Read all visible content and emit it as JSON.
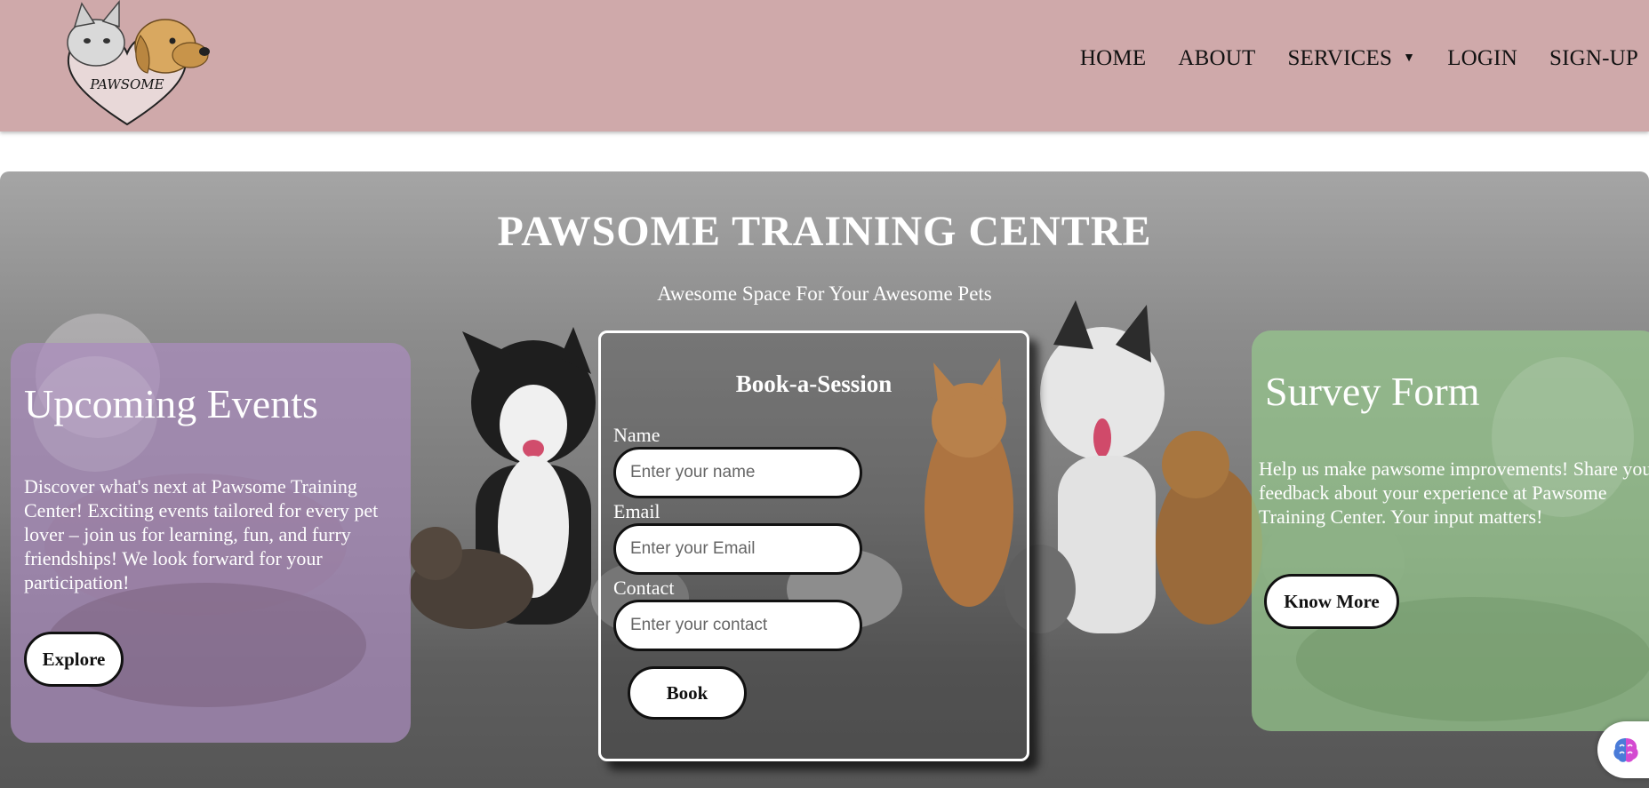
{
  "brand": {
    "logo_text": "PAWSOME"
  },
  "nav": {
    "items": [
      {
        "label": "HOME"
      },
      {
        "label": "ABOUT"
      },
      {
        "label": "SERVICES"
      },
      {
        "label": "LOGIN"
      },
      {
        "label": "SIGN-UP"
      }
    ]
  },
  "hero": {
    "title": "PAWSOME TRAINING CENTRE",
    "subtitle": "Awesome Space For Your Awesome Pets"
  },
  "events": {
    "title": "Upcoming Events",
    "text": "Discover what's next at Pawsome Training Center! Exciting events tailored for every pet lover – join us for learning, fun, and furry friendships! We look forward for your participation!",
    "button": "Explore"
  },
  "booking": {
    "title": "Book-a-Session",
    "name_label": "Name",
    "name_placeholder": "Enter your name",
    "email_label": "Email",
    "email_placeholder": "Enter your Email",
    "contact_label": "Contact",
    "contact_placeholder": "Enter your contact",
    "button": "Book"
  },
  "survey": {
    "title": "Survey Form",
    "text": "Help us make pawsome improvements! Share your feedback about your experience at Pawsome Training Center. Your input matters!",
    "button": "Know More"
  },
  "colors": {
    "header_bg": "#cfa9aa",
    "events_card": "#aa8cbe",
    "survey_card": "#96c88c"
  },
  "icons": {
    "services_dropdown": "caret-down-icon",
    "assistant_widget": "brain-icon"
  }
}
